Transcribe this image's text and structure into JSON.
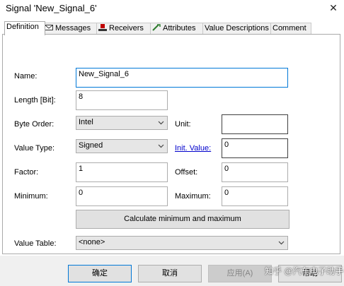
{
  "window": {
    "title": "Signal 'New_Signal_6'"
  },
  "tabs": [
    {
      "label": "Definition",
      "icon": "none"
    },
    {
      "label": "Messages",
      "icon": "envelope-icon"
    },
    {
      "label": "Receivers",
      "icon": "receiver-icon"
    },
    {
      "label": "Attributes",
      "icon": "attributes-icon"
    },
    {
      "label": "Value Descriptions",
      "icon": "none"
    },
    {
      "label": "Comment",
      "icon": "none"
    }
  ],
  "form": {
    "name_label": "Name:",
    "name_value": "New_Signal_6",
    "length_label": "Length [Bit]:",
    "length_value": "8",
    "byte_order_label": "Byte Order:",
    "byte_order_value": "Intel",
    "unit_label": "Unit:",
    "unit_value": "",
    "value_type_label": "Value Type:",
    "value_type_value": "Signed",
    "init_value_label": "Init. Value:",
    "init_value_value": "0",
    "factor_label": "Factor:",
    "factor_value": "1",
    "offset_label": "Offset:",
    "offset_value": "0",
    "minimum_label": "Minimum:",
    "minimum_value": "0",
    "maximum_label": "Maximum:",
    "maximum_value": "0",
    "calc_button": "Calculate minimum and maximum",
    "value_table_label": "Value Table:",
    "value_table_value": "<none>"
  },
  "footer": {
    "ok": "确定",
    "cancel": "取消",
    "apply": "应用(A)",
    "help": "帮助"
  },
  "watermark": "知乎 @汽车电子助手",
  "colors": {
    "focus_border": "#0078d7",
    "link": "#0000cc",
    "dialog_bg": "#f0f0f0"
  }
}
